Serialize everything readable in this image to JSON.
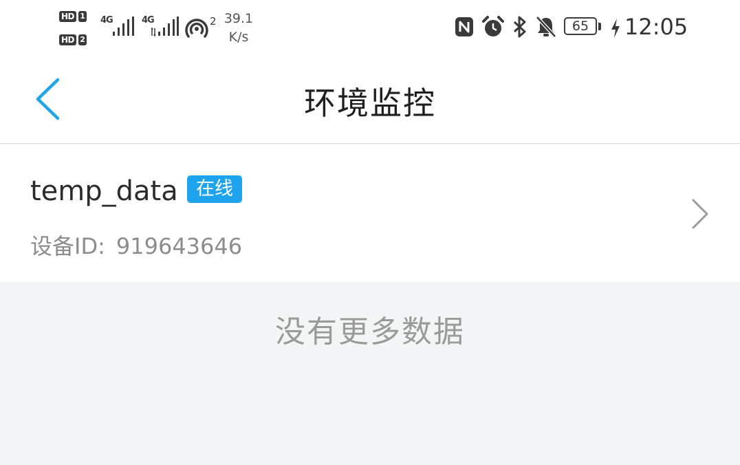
{
  "status_bar": {
    "sim1_badge": "HD",
    "sim1_num": "1",
    "sim2_badge": "HD",
    "sim2_num": "2",
    "network1": "4G",
    "network2": "4G",
    "hotspot_count": "2",
    "speed_value": "39.1",
    "speed_unit": "K/s",
    "battery_level": "65",
    "time": "12:05",
    "icons": [
      "nfc-icon",
      "alarm-icon",
      "bluetooth-icon",
      "bell-muted-icon",
      "battery-icon",
      "charging-icon"
    ]
  },
  "nav": {
    "title": "环境监控",
    "back_icon": "chevron-left-icon"
  },
  "device": {
    "name": "temp_data",
    "status": "在线",
    "id_label": "设备ID:",
    "id_value": "919643646"
  },
  "list": {
    "empty_text": "没有更多数据"
  },
  "colors": {
    "accent": "#1ea4ee",
    "footer_bg": "#f1f5f6",
    "secondary_text": "#8c8c8c"
  }
}
